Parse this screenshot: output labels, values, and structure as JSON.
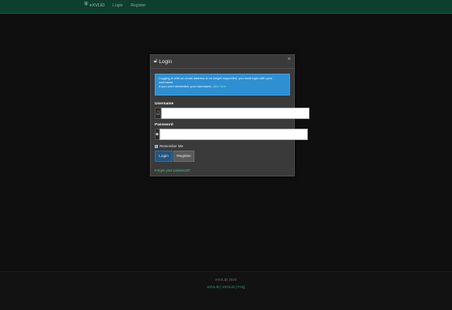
{
  "navbar": {
    "brand_icon": "shield-icon",
    "brand_text": "eXVLiD",
    "links": [
      "Login",
      "Register"
    ]
  },
  "modal": {
    "title_icon": "lock-icon",
    "title": "Login",
    "close_glyph": "×",
    "alert": {
      "line1": "Logging in with an email address is no longer supported, you must login with your username.",
      "line2_prefix": "If you can't remember your username, ",
      "line2_link": "click here"
    },
    "username_label": "Username",
    "username_icon": "user-icon",
    "username_value": "",
    "password_label": "Password",
    "password_icon": "key-icon",
    "password_value": "",
    "remember_label": "Remember Me",
    "remember_checked": true,
    "login_button": "Login",
    "register_button": "Register",
    "forgot_link": "Forgot your password?"
  },
  "footer": {
    "line1": "eXVLiD 2020",
    "line2": "eXVLiD | eXVLiD | FAQ"
  },
  "colors": {
    "navbar_bg": "#0d3f2e",
    "alert_bg": "#2e8fd3",
    "link_green": "#46c28f",
    "login_btn": "#24557f"
  }
}
